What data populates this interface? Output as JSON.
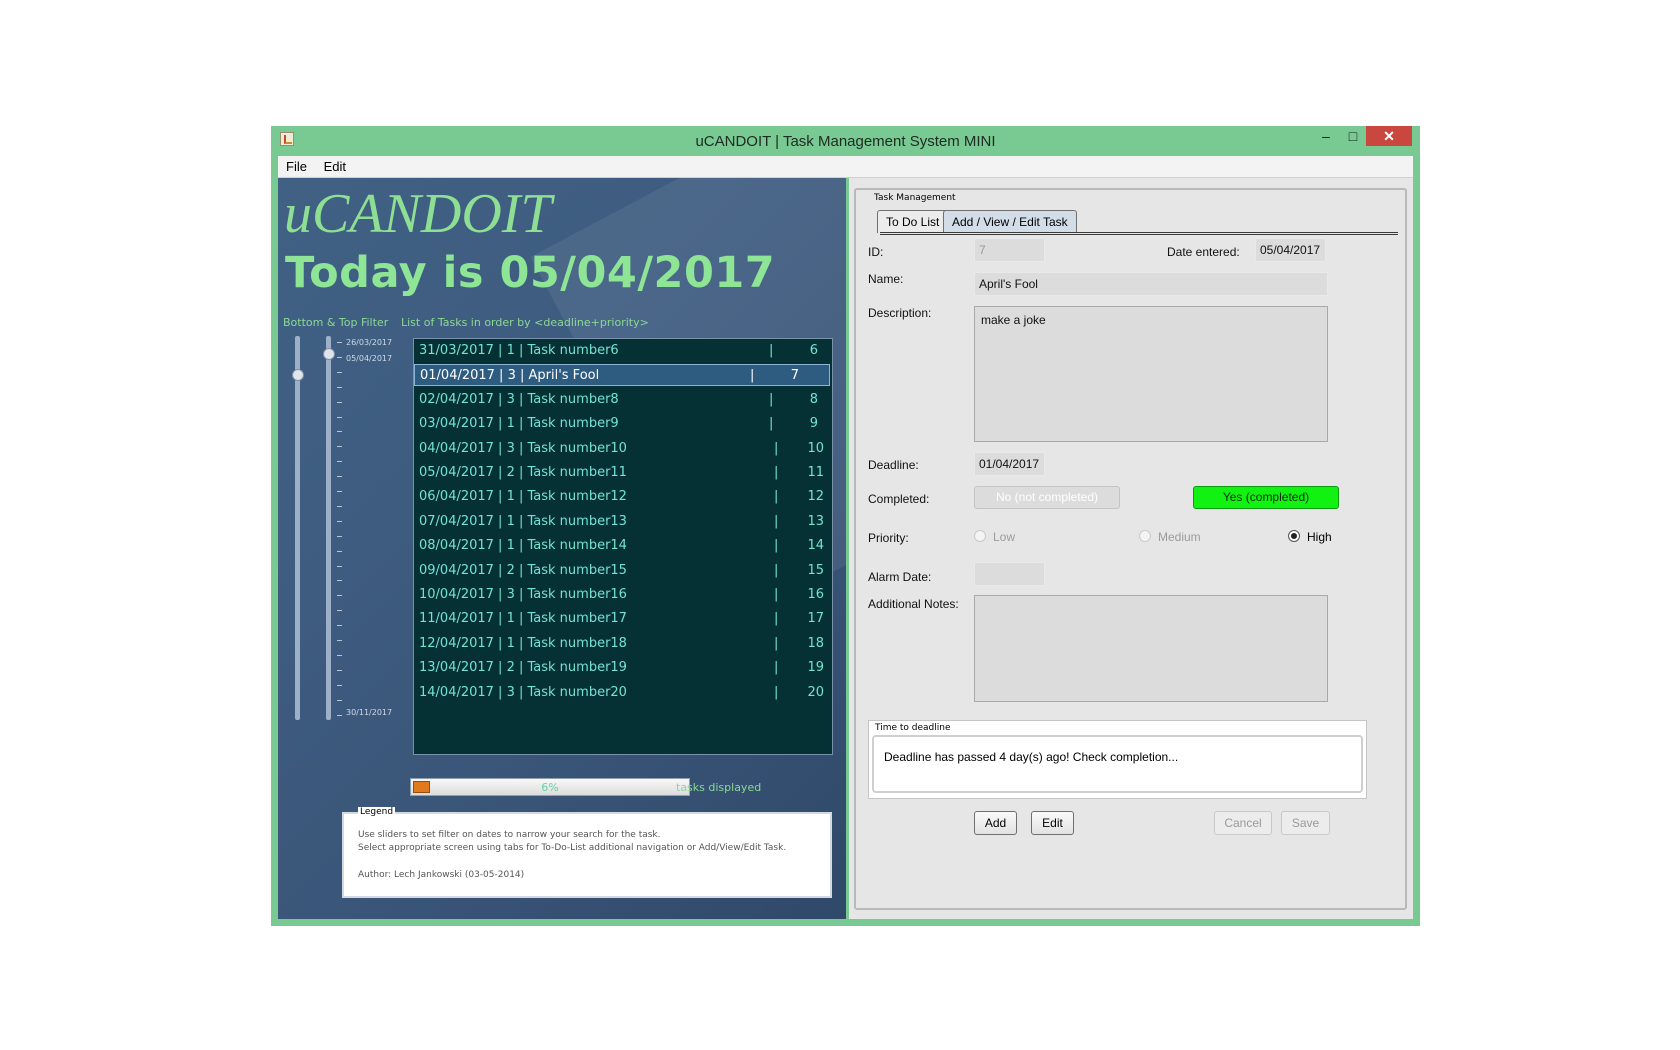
{
  "window": {
    "title": "uCANDOIT | Task Management System MINI",
    "minimize": "–",
    "maximize": "□",
    "close": "✕"
  },
  "menu": [
    "File",
    "Edit"
  ],
  "left": {
    "logo": "uCANDOIT",
    "today": "Today is 05/04/2017",
    "filter_label": "Bottom & Top Filter",
    "list_label": "List of Tasks in order by <deadline+priority>",
    "slider_dates": [
      "26/03/2017",
      "05/04/2017",
      "30/11/2017"
    ],
    "tasks": [
      {
        "text": "31/03/2017 | 1 | Task number6",
        "num": "6"
      },
      {
        "text": "01/04/2017 | 3 | April's Fool",
        "num": "7",
        "selected": true
      },
      {
        "text": "02/04/2017 | 3 | Task number8",
        "num": "8"
      },
      {
        "text": "03/04/2017 | 1 | Task number9",
        "num": "9"
      },
      {
        "text": "04/04/2017 | 3 | Task number10",
        "num": "10"
      },
      {
        "text": "05/04/2017 | 2 | Task number11",
        "num": "11"
      },
      {
        "text": "06/04/2017 | 1 | Task number12",
        "num": "12"
      },
      {
        "text": "07/04/2017 | 1 | Task number13",
        "num": "13"
      },
      {
        "text": "08/04/2017 | 1 | Task number14",
        "num": "14"
      },
      {
        "text": "09/04/2017 | 2 | Task number15",
        "num": "15"
      },
      {
        "text": "10/04/2017 | 3 | Task number16",
        "num": "16"
      },
      {
        "text": "11/04/2017 | 1 | Task number17",
        "num": "17"
      },
      {
        "text": "12/04/2017 | 1 | Task number18",
        "num": "18"
      },
      {
        "text": "13/04/2017 | 2 | Task number19",
        "num": "19"
      },
      {
        "text": "14/04/2017 | 3 | Task number20",
        "num": "20"
      }
    ],
    "task_separator": "|",
    "progress": {
      "value": 0.06,
      "text": "6%"
    },
    "tasks_displayed": "tasks displayed",
    "legend": {
      "title": "Legend",
      "line1": "Use sliders to set filter on dates to narrow your search for the task.",
      "line2": "Select appropriate screen using tabs for To-Do-List additional navigation or Add/View/Edit Task.",
      "author": "Author: Lech Jankowski (03-05-2014)"
    }
  },
  "right": {
    "group_title": "Task Management",
    "tabs": [
      "To Do List",
      "Add / View / Edit Task"
    ],
    "active_tab": 1,
    "fields": {
      "id_label": "ID:",
      "id_value": "7",
      "date_entered_label": "Date entered:",
      "date_entered_value": "05/04/2017",
      "name_label": "Name:",
      "name_value": "April's Fool",
      "description_label": "Description:",
      "description_value": "make a joke",
      "deadline_label": "Deadline:",
      "deadline_value": "01/04/2017",
      "completed_label": "Completed:",
      "not_completed_btn": "No (not completed)",
      "completed_btn": "Yes (completed)",
      "priority_label": "Priority:",
      "priority_options": [
        "Low",
        "Medium",
        "High"
      ],
      "priority_selected": "High",
      "alarm_label": "Alarm Date:",
      "alarm_value": "",
      "notes_label": "Additional Notes:",
      "notes_value": ""
    },
    "time_to_deadline": {
      "title": "Time to deadline",
      "message": "Deadline has passed 4 day(s) ago! Check completion..."
    },
    "buttons": {
      "add": "Add",
      "edit": "Edit",
      "cancel": "Cancel",
      "save": "Save"
    }
  },
  "colors": {
    "window_frame": "#79ca92",
    "panel_blue": "#3e5c80",
    "list_bg": "#053135",
    "list_text": "#74e3d3",
    "completed_green": "#12f212",
    "accent_green": "#8fe596"
  }
}
